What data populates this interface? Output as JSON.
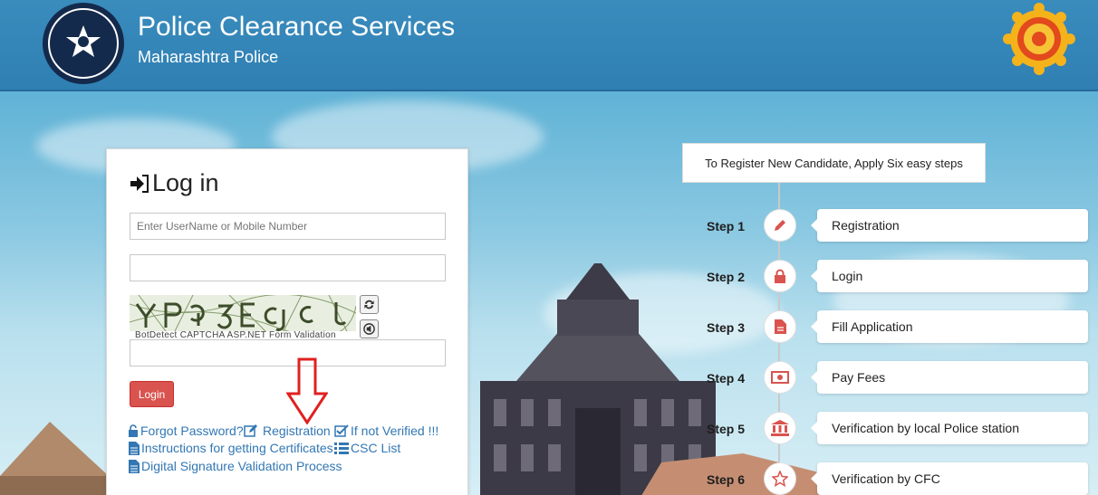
{
  "header": {
    "title": "Police Clearance Services",
    "subtitle": "Maharashtra Police"
  },
  "login": {
    "title": "Log in",
    "username_placeholder": "Enter UserName or Mobile Number",
    "password_value": "",
    "captcha_input_value": "",
    "captcha_caption": "BotDetect CAPTCHA ASP.NET Form Validation",
    "login_label": "Login"
  },
  "links": {
    "forgot_password": "Forgot Password?",
    "registration": "Registration",
    "if_not_verified": "If not Verified !!!",
    "instructions": "Instructions for getting Certificates",
    "csc_list": "CSC List",
    "digital_signature": "Digital Signature Validation Process"
  },
  "steps": {
    "heading": "To Register New Candidate, Apply Six easy steps",
    "items": [
      {
        "step": "Step 1",
        "label": "Registration",
        "icon": "pencil-icon"
      },
      {
        "step": "Step 2",
        "label": "Login",
        "icon": "lock-icon"
      },
      {
        "step": "Step 3",
        "label": "Fill Application",
        "icon": "document-icon"
      },
      {
        "step": "Step 4",
        "label": "Pay Fees",
        "icon": "money-icon"
      },
      {
        "step": "Step 5",
        "label": "Verification by local Police station",
        "icon": "bank-icon"
      },
      {
        "step": "Step 6",
        "label": "Verification by CFC",
        "icon": "star-icon"
      }
    ]
  },
  "colors": {
    "header": "#3a8cbd",
    "login_button": "#d9534f",
    "link": "#3277b3",
    "step_icon": "#d9534f"
  }
}
